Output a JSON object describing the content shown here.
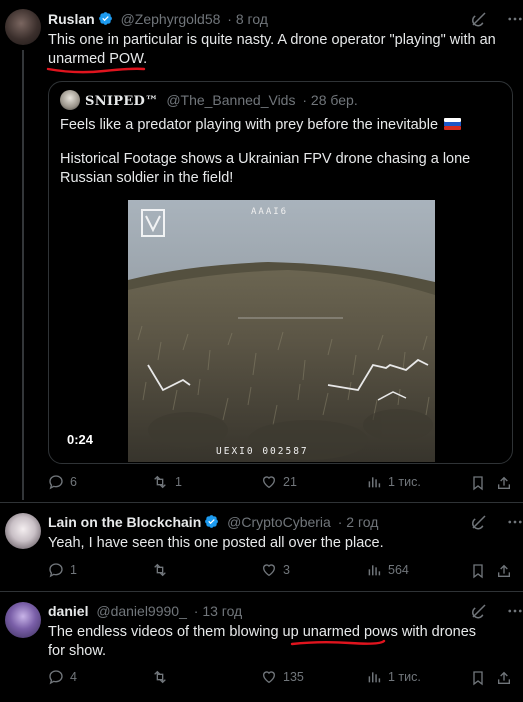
{
  "tweets": [
    {
      "name": "Ruslan",
      "handle": "@Zephyrgold58",
      "time": "· 8 год",
      "text": "This one in particular is quite nasty. A drone operator \"playing\" with an unarmed POW.",
      "actions": {
        "replies": "6",
        "reposts": "1",
        "likes": "21",
        "views": "1 тис."
      }
    },
    {
      "name": "Lain on the Blockchain",
      "handle": "@CryptoCyberia",
      "time": "· 2 год",
      "text": "Yeah, I have seen this one posted all over the place.",
      "actions": {
        "replies": "1",
        "reposts": "",
        "likes": "3",
        "views": "564"
      }
    },
    {
      "name": "daniel",
      "handle": "@daniel9990_",
      "time": "· 13 год",
      "text_before": "The endless videos of them blowing up ",
      "text_underlined": "unarmed pows",
      "text_after": " with drones for show.",
      "actions": {
        "replies": "4",
        "reposts": "",
        "likes": "135",
        "views": "1 тис."
      }
    }
  ],
  "quote": {
    "name": "SNIPED™",
    "handle": "@The_Banned_Vids",
    "time": "· 28 бер.",
    "text_line1": "Feels like a predator playing with prey before the inevitable",
    "text_line2": "Historical Footage shows a Ukrainian FPV drone chasing  a lone Russian soldier in the field!",
    "video_duration": "0:24",
    "osd_top": "AAAI6",
    "osd_bottom": "UEXI0  002587"
  },
  "colors": {
    "background": "#000000",
    "text": "#e7e9ea",
    "muted": "#71767b",
    "verified": "#1d9bf0",
    "divider": "#2f3336",
    "annotation_red": "#e0141e"
  },
  "icons": [
    "grok-icon",
    "more-icon",
    "reply-icon",
    "repost-icon",
    "like-icon",
    "views-icon",
    "bookmark-icon",
    "share-icon",
    "verified-badge-icon",
    "russian-flag-icon"
  ]
}
